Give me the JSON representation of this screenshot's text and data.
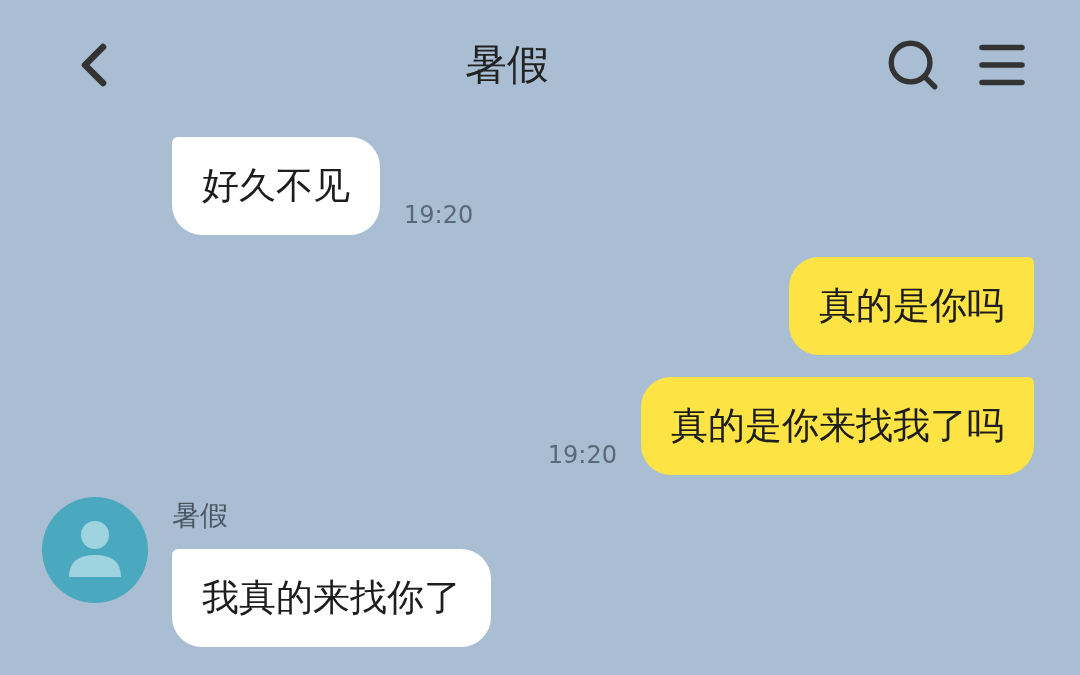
{
  "header": {
    "title": "暑假"
  },
  "messages": [
    {
      "kind": "incoming",
      "text": "好久不见",
      "time": "19:20"
    },
    {
      "kind": "outgoing",
      "text": "真的是你吗"
    },
    {
      "kind": "outgoing",
      "text": "真的是你来找我了吗",
      "time": "19:20"
    },
    {
      "kind": "incoming",
      "sender": "暑假",
      "text": "我真的来找你了"
    }
  ]
}
